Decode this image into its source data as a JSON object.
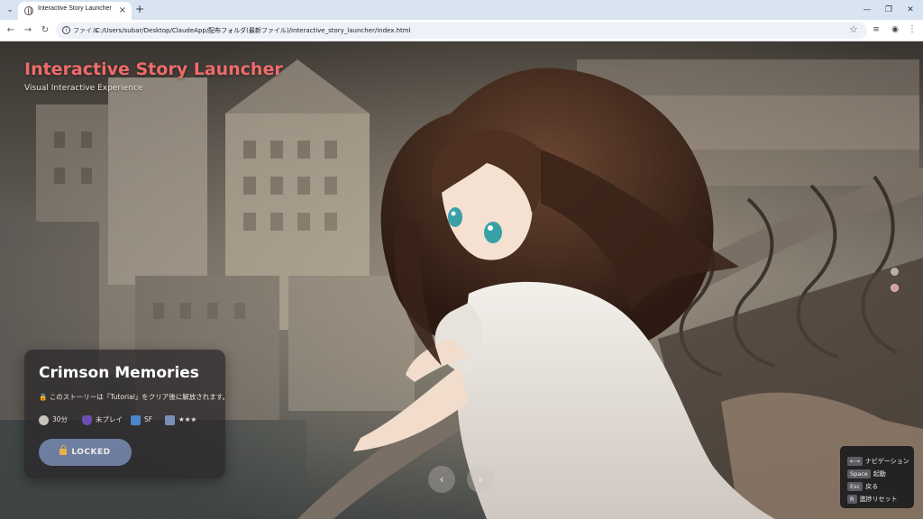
{
  "browser": {
    "tab_title": "Interactive Story Launcher",
    "omnibox_label": "ファイル",
    "url": "C:/Users/subar/Desktop/ClaudeApp/配布フォルダ(最新ファイル)/interactive_story_launcher/index.html"
  },
  "header": {
    "title": "Interactive Story Launcher",
    "subtitle": "Visual Interactive Experience"
  },
  "story_card": {
    "title": "Crimson Memories",
    "lock_note": "🔒 このストーリーは「Tutorial」をクリア後に解放されます。",
    "meta": {
      "duration": "30分",
      "status": "未プレイ",
      "genre": "SF",
      "rating": "★★★"
    },
    "locked_label": "LOCKED"
  },
  "pager": {
    "prev": "‹",
    "next": "›"
  },
  "help": {
    "items": [
      {
        "key": "←→",
        "label": "ナビゲーション"
      },
      {
        "key": "Space",
        "label": "起動"
      },
      {
        "key": "Esc",
        "label": "戻る"
      },
      {
        "key": "R",
        "label": "進捗リセット"
      }
    ]
  },
  "colors": {
    "title_accent": "#ee6b6b",
    "locked_button": "#6d7ea0",
    "card_bg": "#282628",
    "dot_inactive": "#b8b0ae",
    "dot_active": "#d49aa6"
  }
}
